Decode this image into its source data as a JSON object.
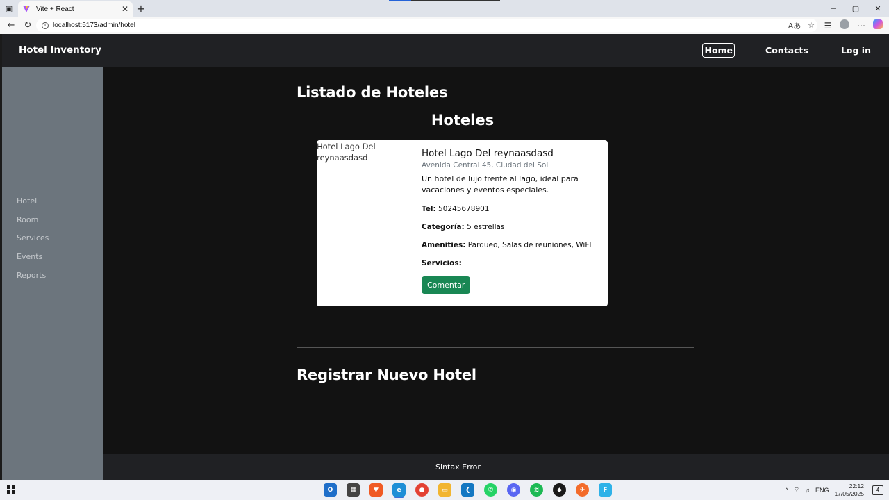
{
  "browser": {
    "tab_title": "Vite + React",
    "tab_close": "✕",
    "new_tab": "+",
    "url": "localhost:5173/admin/hotel",
    "window_controls": [
      "─",
      "▢",
      "✕"
    ]
  },
  "app": {
    "brand": "Hotel Inventory",
    "nav": {
      "home": "Home",
      "contacts": "Contacts",
      "login": "Log in"
    },
    "sidebar": {
      "items": [
        {
          "label": "Hotel"
        },
        {
          "label": "Room"
        },
        {
          "label": "Services"
        },
        {
          "label": "Events"
        },
        {
          "label": "Reports"
        }
      ]
    },
    "main": {
      "list_title": "Listado de Hoteles",
      "section_title": "Hoteles",
      "hotel": {
        "image_alt": "Hotel Lago Del reynaasdasd",
        "name": "Hotel Lago Del reynaasdasd",
        "address": "Avenida Central 45, Ciudad del Sol",
        "description": "Un hotel de lujo frente al lago, ideal para vacaciones y eventos especiales.",
        "tel_label": "Tel:",
        "tel": "50245678901",
        "category_label": "Categoría:",
        "category": "5 estrellas",
        "amenities_label": "Amenities:",
        "amenities": "Parqueo, Salas de reuniones, WiFI",
        "services_label": "Servicios:",
        "services": "",
        "comment_button": "Comentar"
      },
      "register_title": "Registrar Nuevo Hotel"
    },
    "footer": "Sintax Error"
  },
  "taskbar": {
    "language": "ENG",
    "time": "22:12",
    "date": "17/05/2025",
    "notifications": "4"
  },
  "colors": {
    "navbar_bg": "#202124",
    "sidebar_bg": "#6c757d",
    "content_bg": "#121212",
    "button_success": "#198754"
  }
}
